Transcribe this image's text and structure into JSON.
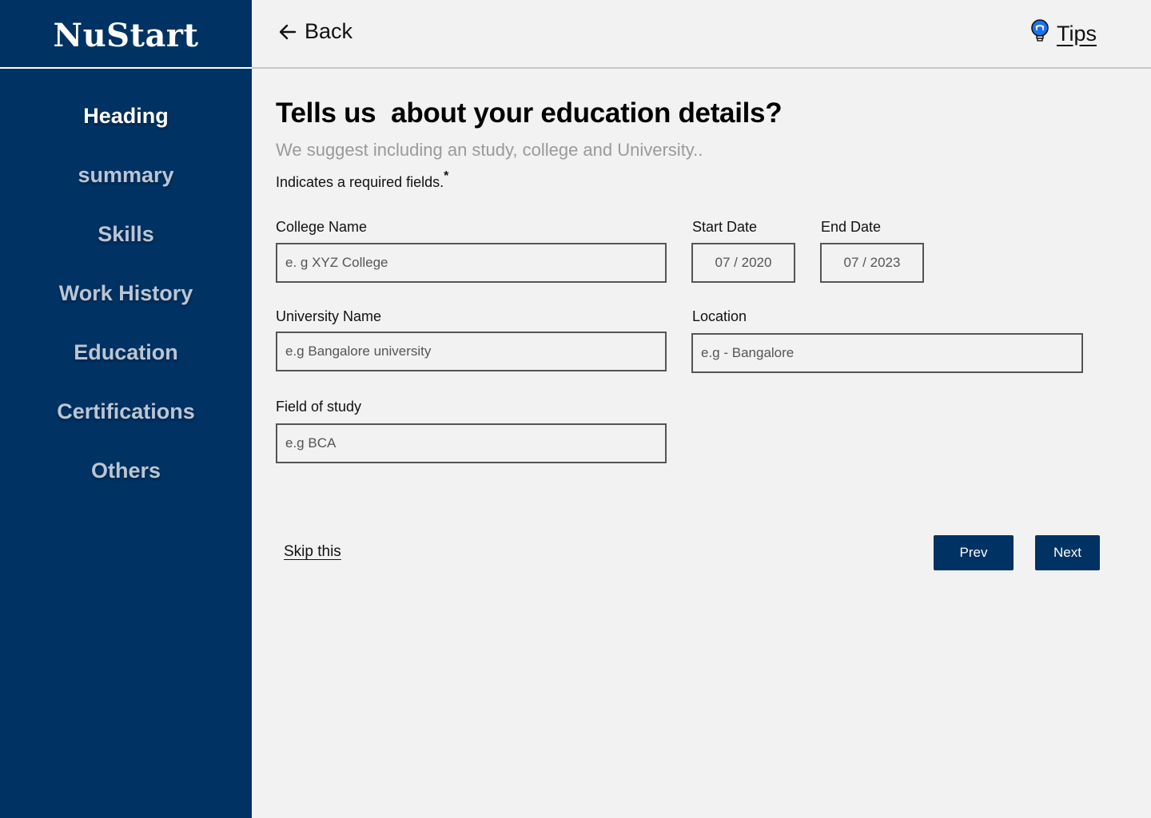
{
  "app": {
    "brand": "NuStart"
  },
  "sidebar": {
    "items": [
      {
        "label": "Heading",
        "active": true
      },
      {
        "label": "summary",
        "active": false
      },
      {
        "label": "Skills",
        "active": false
      },
      {
        "label": "Work History",
        "active": false
      },
      {
        "label": "Education",
        "active": false
      },
      {
        "label": "Certifications",
        "active": false
      },
      {
        "label": "Others",
        "active": false
      }
    ]
  },
  "topbar": {
    "back_label": "Back",
    "back_icon": "arrow-left-icon",
    "tips_label": "Tips",
    "tips_icon": "lightbulb-icon"
  },
  "form": {
    "title": "Tells us  about your education details?",
    "subtitle": "We suggest including an study, college and University..",
    "required_note": "Indicates a required fields.",
    "required_mark": "*",
    "fields": {
      "college_name": {
        "label": "College Name",
        "placeholder": "e. g XYZ College",
        "value": ""
      },
      "start_date": {
        "label": "Start Date",
        "placeholder": "07 / 2020",
        "value": ""
      },
      "end_date": {
        "label": "End Date",
        "placeholder": "07 / 2023",
        "value": ""
      },
      "university_name": {
        "label": "University Name",
        "placeholder": "e.g Bangalore university",
        "value": ""
      },
      "location": {
        "label": "Location",
        "placeholder": "e.g - Bangalore",
        "value": ""
      },
      "field_of_study": {
        "label": "Field of study",
        "placeholder": "e.g BCA",
        "value": ""
      }
    }
  },
  "actions": {
    "skip_label": "Skip this",
    "prev_label": "Prev",
    "next_label": "Next"
  },
  "colors": {
    "brand": "#003263",
    "background": "#f2f2f2",
    "sidebar_inactive_text": "#b9c6d6",
    "tips_icon": "#1a73e8"
  }
}
